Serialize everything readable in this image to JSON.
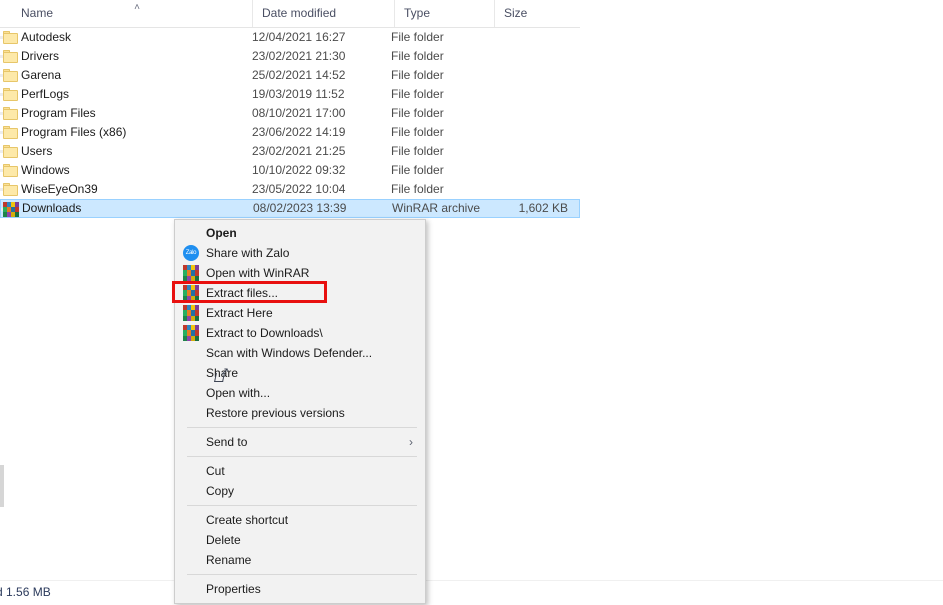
{
  "window": {
    "status_bar_text": "d  1.56 MB"
  },
  "file_list": {
    "columns": [
      {
        "label": "Name",
        "sort_icon": "sort-ascending-caret"
      },
      {
        "label": "Date modified"
      },
      {
        "label": "Type"
      },
      {
        "label": "Size"
      }
    ],
    "sort_caret_glyph": "˄",
    "rows": [
      {
        "name": "Autodesk",
        "date": "12/04/2021 16:27",
        "type": "File folder",
        "size": "",
        "icon": "folder-icon",
        "selected": false
      },
      {
        "name": "Drivers",
        "date": "23/02/2021 21:30",
        "type": "File folder",
        "size": "",
        "icon": "folder-icon",
        "selected": false
      },
      {
        "name": "Garena",
        "date": "25/02/2021 14:52",
        "type": "File folder",
        "size": "",
        "icon": "folder-icon",
        "selected": false
      },
      {
        "name": "PerfLogs",
        "date": "19/03/2019 11:52",
        "type": "File folder",
        "size": "",
        "icon": "folder-icon",
        "selected": false
      },
      {
        "name": "Program Files",
        "date": "08/10/2021 17:00",
        "type": "File folder",
        "size": "",
        "icon": "folder-icon",
        "selected": false
      },
      {
        "name": "Program Files (x86)",
        "date": "23/06/2022 14:19",
        "type": "File folder",
        "size": "",
        "icon": "folder-icon",
        "selected": false
      },
      {
        "name": "Users",
        "date": "23/02/2021 21:25",
        "type": "File folder",
        "size": "",
        "icon": "folder-icon",
        "selected": false
      },
      {
        "name": "Windows",
        "date": "10/10/2022 09:32",
        "type": "File folder",
        "size": "",
        "icon": "folder-icon",
        "selected": false
      },
      {
        "name": "WiseEyeOn39",
        "date": "23/05/2022 10:04",
        "type": "File folder",
        "size": "",
        "icon": "folder-icon",
        "selected": false
      },
      {
        "name": "Downloads",
        "date": "08/02/2023 13:39",
        "type": "WinRAR archive",
        "size": "1,602 KB",
        "icon": "winrar-archive-icon",
        "selected": true
      }
    ]
  },
  "context_menu": {
    "items": [
      {
        "label": "Open",
        "icon": null,
        "bold": true,
        "type": "item"
      },
      {
        "label": "Share with Zalo",
        "icon": "zalo-icon",
        "bold": false,
        "type": "item"
      },
      {
        "label": "Open with WinRAR",
        "icon": "winrar-icon",
        "bold": false,
        "type": "item"
      },
      {
        "label": "Extract files...",
        "icon": "winrar-icon",
        "bold": false,
        "type": "item",
        "highlighted": true
      },
      {
        "label": "Extract Here",
        "icon": "winrar-icon",
        "bold": false,
        "type": "item"
      },
      {
        "label": "Extract to Downloads\\",
        "icon": "winrar-icon",
        "bold": false,
        "type": "item"
      },
      {
        "label": "Scan with Windows Defender...",
        "icon": "defender-shield-icon",
        "bold": false,
        "type": "item"
      },
      {
        "label": "Share",
        "icon": "share-arrow-icon",
        "bold": false,
        "type": "item"
      },
      {
        "label": "Open with...",
        "icon": null,
        "bold": false,
        "type": "item"
      },
      {
        "label": "Restore previous versions",
        "icon": null,
        "bold": false,
        "type": "item"
      },
      {
        "type": "separator"
      },
      {
        "label": "Send to",
        "icon": null,
        "bold": false,
        "type": "item",
        "submenu": true
      },
      {
        "type": "separator"
      },
      {
        "label": "Cut",
        "icon": null,
        "bold": false,
        "type": "item"
      },
      {
        "label": "Copy",
        "icon": null,
        "bold": false,
        "type": "item"
      },
      {
        "type": "separator"
      },
      {
        "label": "Create shortcut",
        "icon": null,
        "bold": false,
        "type": "item"
      },
      {
        "label": "Delete",
        "icon": null,
        "bold": false,
        "type": "item"
      },
      {
        "label": "Rename",
        "icon": null,
        "bold": false,
        "type": "item"
      },
      {
        "type": "separator"
      },
      {
        "label": "Properties",
        "icon": null,
        "bold": false,
        "type": "item"
      }
    ],
    "submenu_arrow_glyph": "›",
    "zalo_icon_text": "Zalo"
  },
  "annotation": {
    "highlight_color": "#e8100f",
    "target_label": "Extract files..."
  },
  "colors": {
    "selection_fill": "#cce8ff",
    "selection_border": "#99d1ff",
    "menu_background": "#f2f2f2",
    "annotation_red": "#e8100f",
    "folder_yellow": "#fde9a9"
  }
}
